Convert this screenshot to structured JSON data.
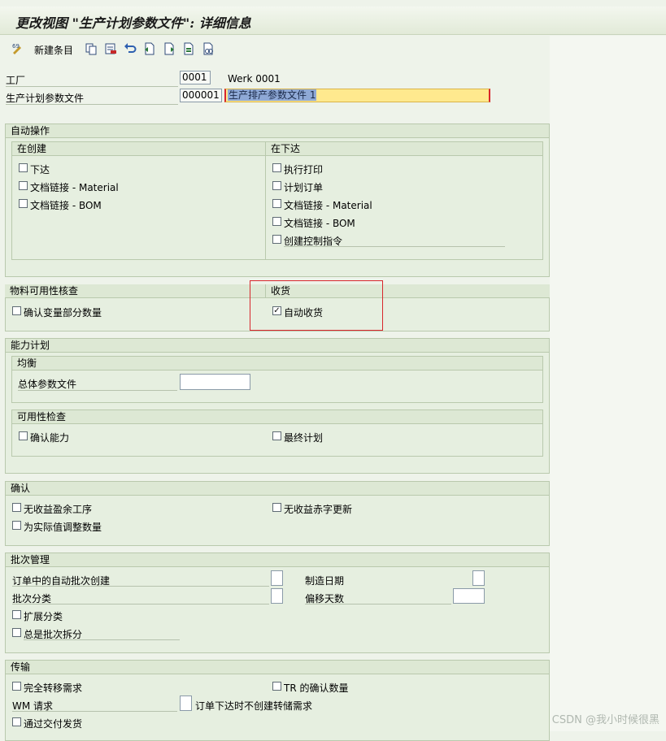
{
  "title": "更改视图 \"生产计划参数文件\": 详细信息",
  "toolbar": {
    "new_entries_label": "新建条目",
    "icons": [
      "display-change-icon",
      "copy-icon",
      "delete-icon",
      "undo-icon",
      "previous-entry-icon",
      "next-entry-icon",
      "select-all-icon",
      "where-used-icon",
      "other-entry-icon"
    ]
  },
  "header": {
    "plant_label": "工厂",
    "plant_value": "0001",
    "plant_desc": "Werk 0001",
    "profile_label": "生产计划参数文件",
    "profile_value": "000001",
    "profile_desc": "生产排产参数文件 1"
  },
  "auto_ops": {
    "title": "自动操作",
    "on_create": {
      "title": "在创建",
      "items": [
        {
          "label": "下达",
          "checked": false
        },
        {
          "label": "文档链接 - Material",
          "checked": false
        },
        {
          "label": "文档链接 - BOM",
          "checked": false
        }
      ]
    },
    "on_release": {
      "title": "在下达",
      "items": [
        {
          "label": "执行打印",
          "checked": false
        },
        {
          "label": "计划订单",
          "checked": false
        },
        {
          "label": "文档链接 - Material",
          "checked": false
        },
        {
          "label": "文档链接 - BOM",
          "checked": false
        },
        {
          "label": "创建控制指令",
          "checked": false
        }
      ]
    }
  },
  "material_check": {
    "title": "物料可用性核查",
    "confirm_partial": {
      "label": "确认变量部分数量",
      "checked": false
    }
  },
  "goods_receipt": {
    "title": "收货",
    "auto_gr": {
      "label": "自动收货",
      "checked": true
    }
  },
  "capacity": {
    "title": "能力计划",
    "leveling": {
      "title": "均衡",
      "overall_profile_label": "总体参数文件",
      "overall_profile_value": ""
    },
    "availability": {
      "title": "可用性检查",
      "confirm_capacity": {
        "label": "确认能力",
        "checked": false
      },
      "finite_scheduling": {
        "label": "最终计划",
        "checked": false
      }
    }
  },
  "confirmation": {
    "title": "确认",
    "items": [
      {
        "label": "无收益盈余工序",
        "checked": false
      },
      {
        "label": "无收益赤字更新",
        "checked": false
      },
      {
        "label": "为实际值调整数量",
        "checked": false
      }
    ]
  },
  "batch": {
    "title": "批次管理",
    "auto_batch_label": "订单中的自动批次创建",
    "auto_batch_value": "",
    "mfg_date_label": "制造日期",
    "mfg_date_value": "",
    "classification_label": "批次分类",
    "classification_value": "",
    "offset_days_label": "偏移天数",
    "offset_days_value": "",
    "extended_class": {
      "label": "扩展分类",
      "checked": false
    },
    "always_split": {
      "label": "总是批次拆分",
      "checked": false
    }
  },
  "transfer": {
    "title": "传输",
    "full_transfer": {
      "label": "完全转移需求",
      "checked": false
    },
    "tr_confirm_qty": {
      "label": "TR 的确认数量",
      "checked": false
    },
    "wm_request_label": "WM 请求",
    "wm_request_value": "",
    "no_tr_on_release_label": "订单下达时不创建转储需求",
    "goods_issue_delivery": {
      "label": "通过交付发货",
      "checked": false
    }
  },
  "watermark": "CSDN @我小时候很黑"
}
